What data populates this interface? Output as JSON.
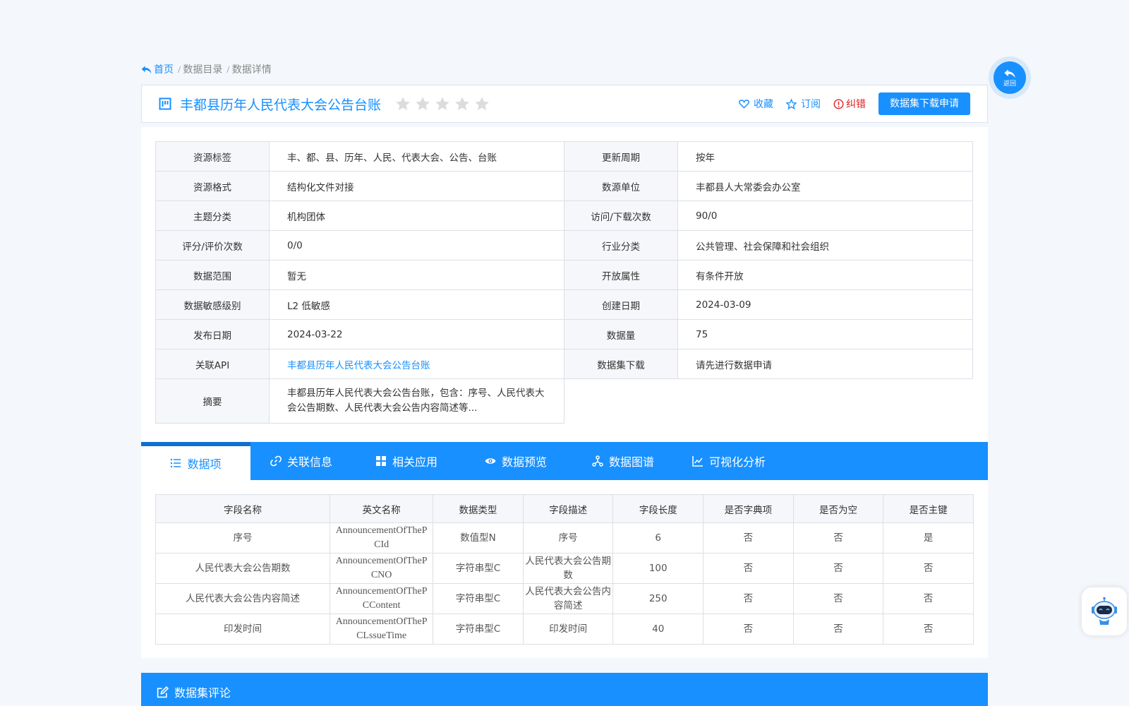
{
  "breadcrumb": {
    "home": "首页",
    "catalog": "/ 数据目录",
    "detail": "/ 数据详情"
  },
  "header": {
    "title": "丰都县历年人民代表大会公告台账",
    "rating": 0,
    "rating_max": 5,
    "favorite": "收藏",
    "subscribe": "订阅",
    "report": "纠错",
    "apply": "数据集下载申请"
  },
  "info": {
    "rows": [
      {
        "l1": "资源标签",
        "v1": "丰、都、县、历年、人民、代表大会、公告、台账",
        "l2": "更新周期",
        "v2": "按年"
      },
      {
        "l1": "资源格式",
        "v1": "结构化文件对接",
        "l2": "数源单位",
        "v2": "丰都县人大常委会办公室"
      },
      {
        "l1": "主题分类",
        "v1": "机构团体",
        "l2": "访问/下载次数",
        "v2": "90/0"
      },
      {
        "l1": "评分/评价次数",
        "v1": "0/0",
        "l2": "行业分类",
        "v2": "公共管理、社会保障和社会组织"
      },
      {
        "l1": "数据范围",
        "v1": "暂无",
        "l2": "开放属性",
        "v2": "有条件开放"
      },
      {
        "l1": "数据敏感级别",
        "v1": "L2 低敏感",
        "l2": "创建日期",
        "v2": "2024-03-09"
      },
      {
        "l1": "发布日期",
        "v1": "2024-03-22",
        "l2": "数据量",
        "v2": "75"
      },
      {
        "l1": "关联API",
        "v1": "丰都县历年人民代表大会公告台账",
        "l2": "数据集下载",
        "v2": "请先进行数据申请"
      }
    ],
    "summary_label": "摘要",
    "summary": "丰都县历年人民代表大会公告台账，包含：序号、人民代表大会公告期数、人民代表大会公告内容简述等..."
  },
  "tabs": [
    "数据项",
    "关联信息",
    "相关应用",
    "数据预览",
    "数据图谱",
    "可视化分析"
  ],
  "fields": {
    "headers": [
      "字段名称",
      "英文名称",
      "数据类型",
      "字段描述",
      "字段长度",
      "是否字典项",
      "是否为空",
      "是否主键"
    ],
    "rows": [
      [
        "序号",
        "AnnouncementOfThePCId",
        "数值型N",
        "序号",
        "6",
        "否",
        "否",
        "是"
      ],
      [
        "人民代表大会公告期数",
        "AnnouncementOfThePCNO",
        "字符串型C",
        "人民代表大会公告期数",
        "100",
        "否",
        "否",
        "否"
      ],
      [
        "人民代表大会公告内容简述",
        "AnnouncementOfThePCContent",
        "字符串型C",
        "人民代表大会公告内容简述",
        "250",
        "否",
        "否",
        "否"
      ],
      [
        "印发时间",
        "AnnouncementOfThePCLssueTime",
        "字符串型C",
        "印发时间",
        "40",
        "否",
        "否",
        "否"
      ]
    ]
  },
  "comments_title": "数据集评论",
  "back_label": "返回",
  "colors": {
    "primary": "#1890ff",
    "danger": "#e02020",
    "star": "#dcdcdc"
  }
}
